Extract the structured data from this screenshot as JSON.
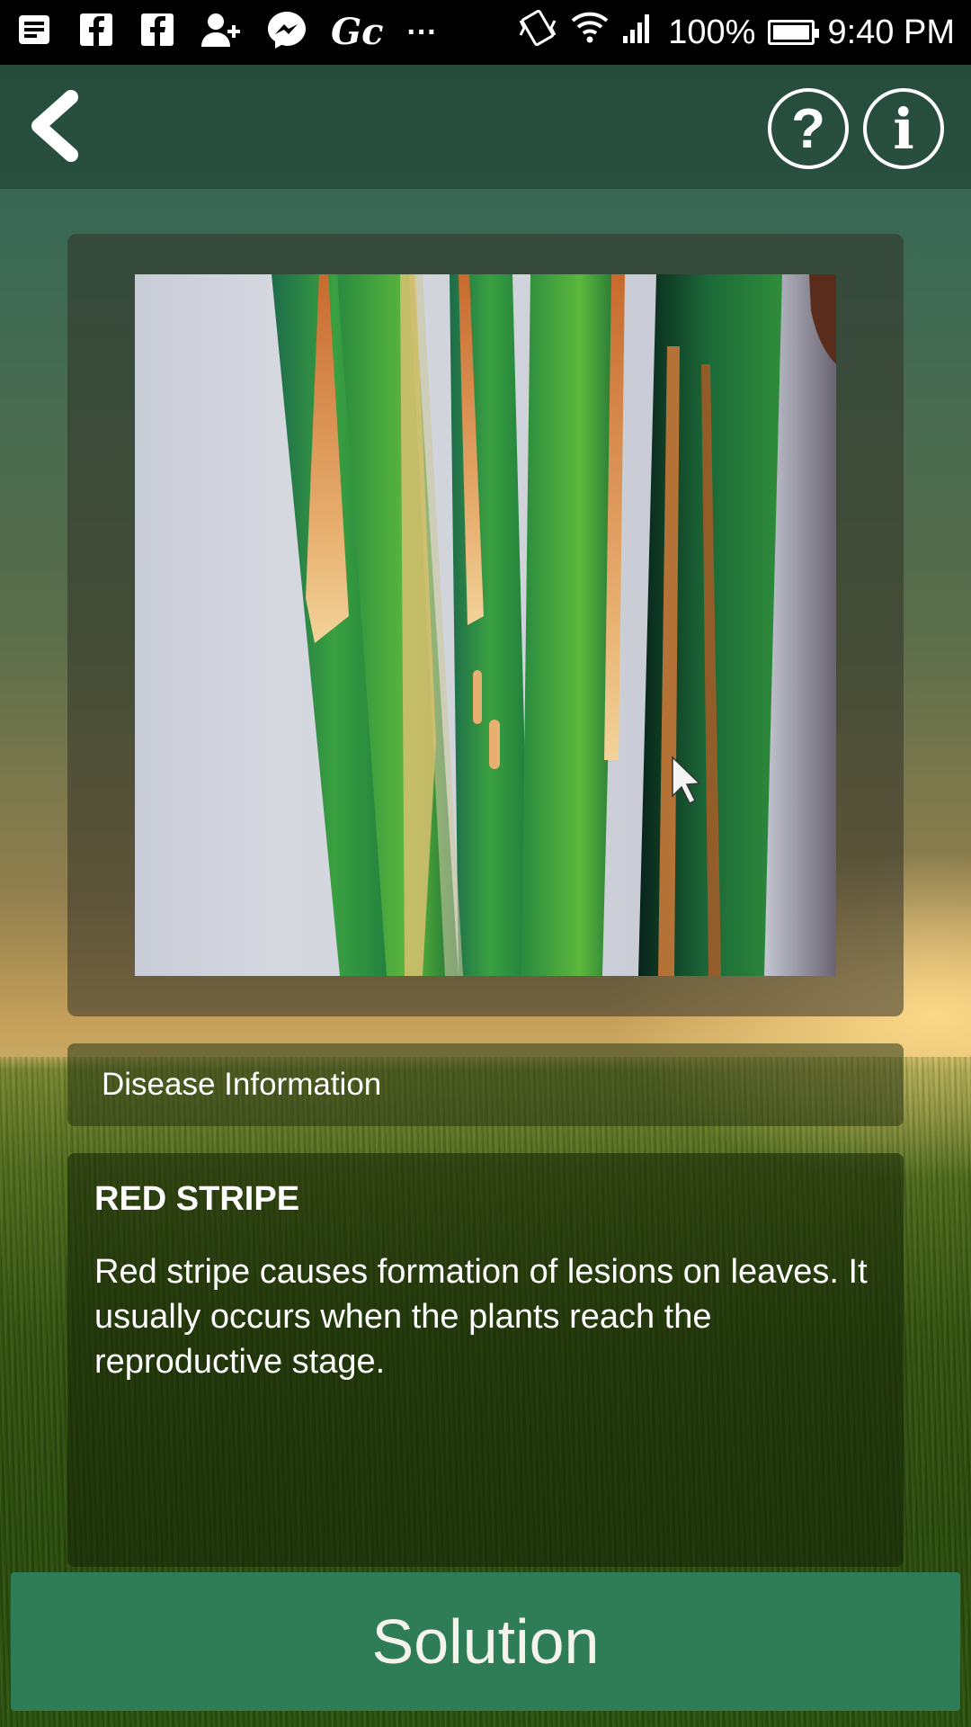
{
  "status_bar": {
    "notification_icons": [
      "news-icon",
      "facebook-icon",
      "facebook-icon",
      "add-contact-icon",
      "messenger-icon",
      "gc-icon"
    ],
    "more": "···",
    "battery": "100%",
    "time": "9:40 PM"
  },
  "header": {
    "back_icon": "chevron-left-icon",
    "help_label": "?",
    "info_label": "i"
  },
  "disease": {
    "section_title": "Disease Information",
    "name": "RED STRIPE",
    "description": "Red stripe causes formation of lesions on leaves. It usually occurs when the plants reach the reproductive stage."
  },
  "actions": {
    "solution_label": "Solution"
  },
  "colors": {
    "button_green": "#2e7d56",
    "header_green": "#2e5e4c"
  }
}
